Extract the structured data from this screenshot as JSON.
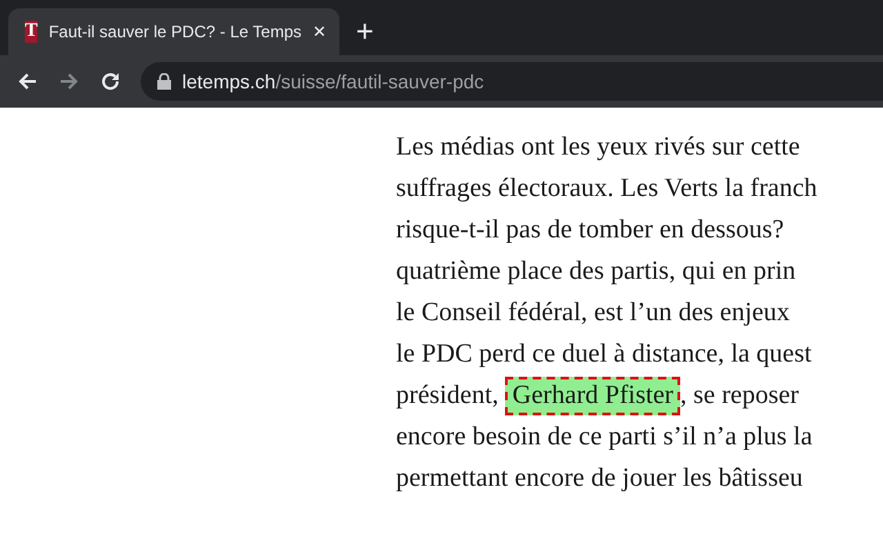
{
  "tab": {
    "title": "Faut-il sauver le PDC? - Le Temps",
    "favicon": "T",
    "close": "✕",
    "new_tab": "+"
  },
  "address_bar": {
    "domain": "letemps.ch",
    "path": "/suisse/fautil-sauver-pdc"
  },
  "article": {
    "lines": [
      [
        {
          "kind": "text",
          "text": "Les médias ont les yeux rivés sur cette"
        }
      ],
      [
        {
          "kind": "text",
          "text": "suffrages électoraux. Les Verts la franch"
        }
      ],
      [
        {
          "kind": "text",
          "text": "risque-t-il pas de tomber en dessous?"
        }
      ],
      [
        {
          "kind": "text",
          "text": "quatrième place des partis, qui en prin"
        }
      ],
      [
        {
          "kind": "text",
          "text": "le Conseil fédéral, est l’un des enjeux"
        }
      ],
      [
        {
          "kind": "text",
          "text": "le PDC perd ce duel à distance, la quest"
        }
      ],
      [
        {
          "kind": "text",
          "text": "président,"
        },
        {
          "kind": "highlight",
          "text": "Gerhard Pfister"
        },
        {
          "kind": "text",
          "text": ", se reposer"
        }
      ],
      [
        {
          "kind": "text",
          "text": "encore besoin de ce parti s’il n’a plus la"
        }
      ],
      [
        {
          "kind": "text",
          "text": "permettant encore de jouer les bâtisseu"
        }
      ]
    ]
  }
}
